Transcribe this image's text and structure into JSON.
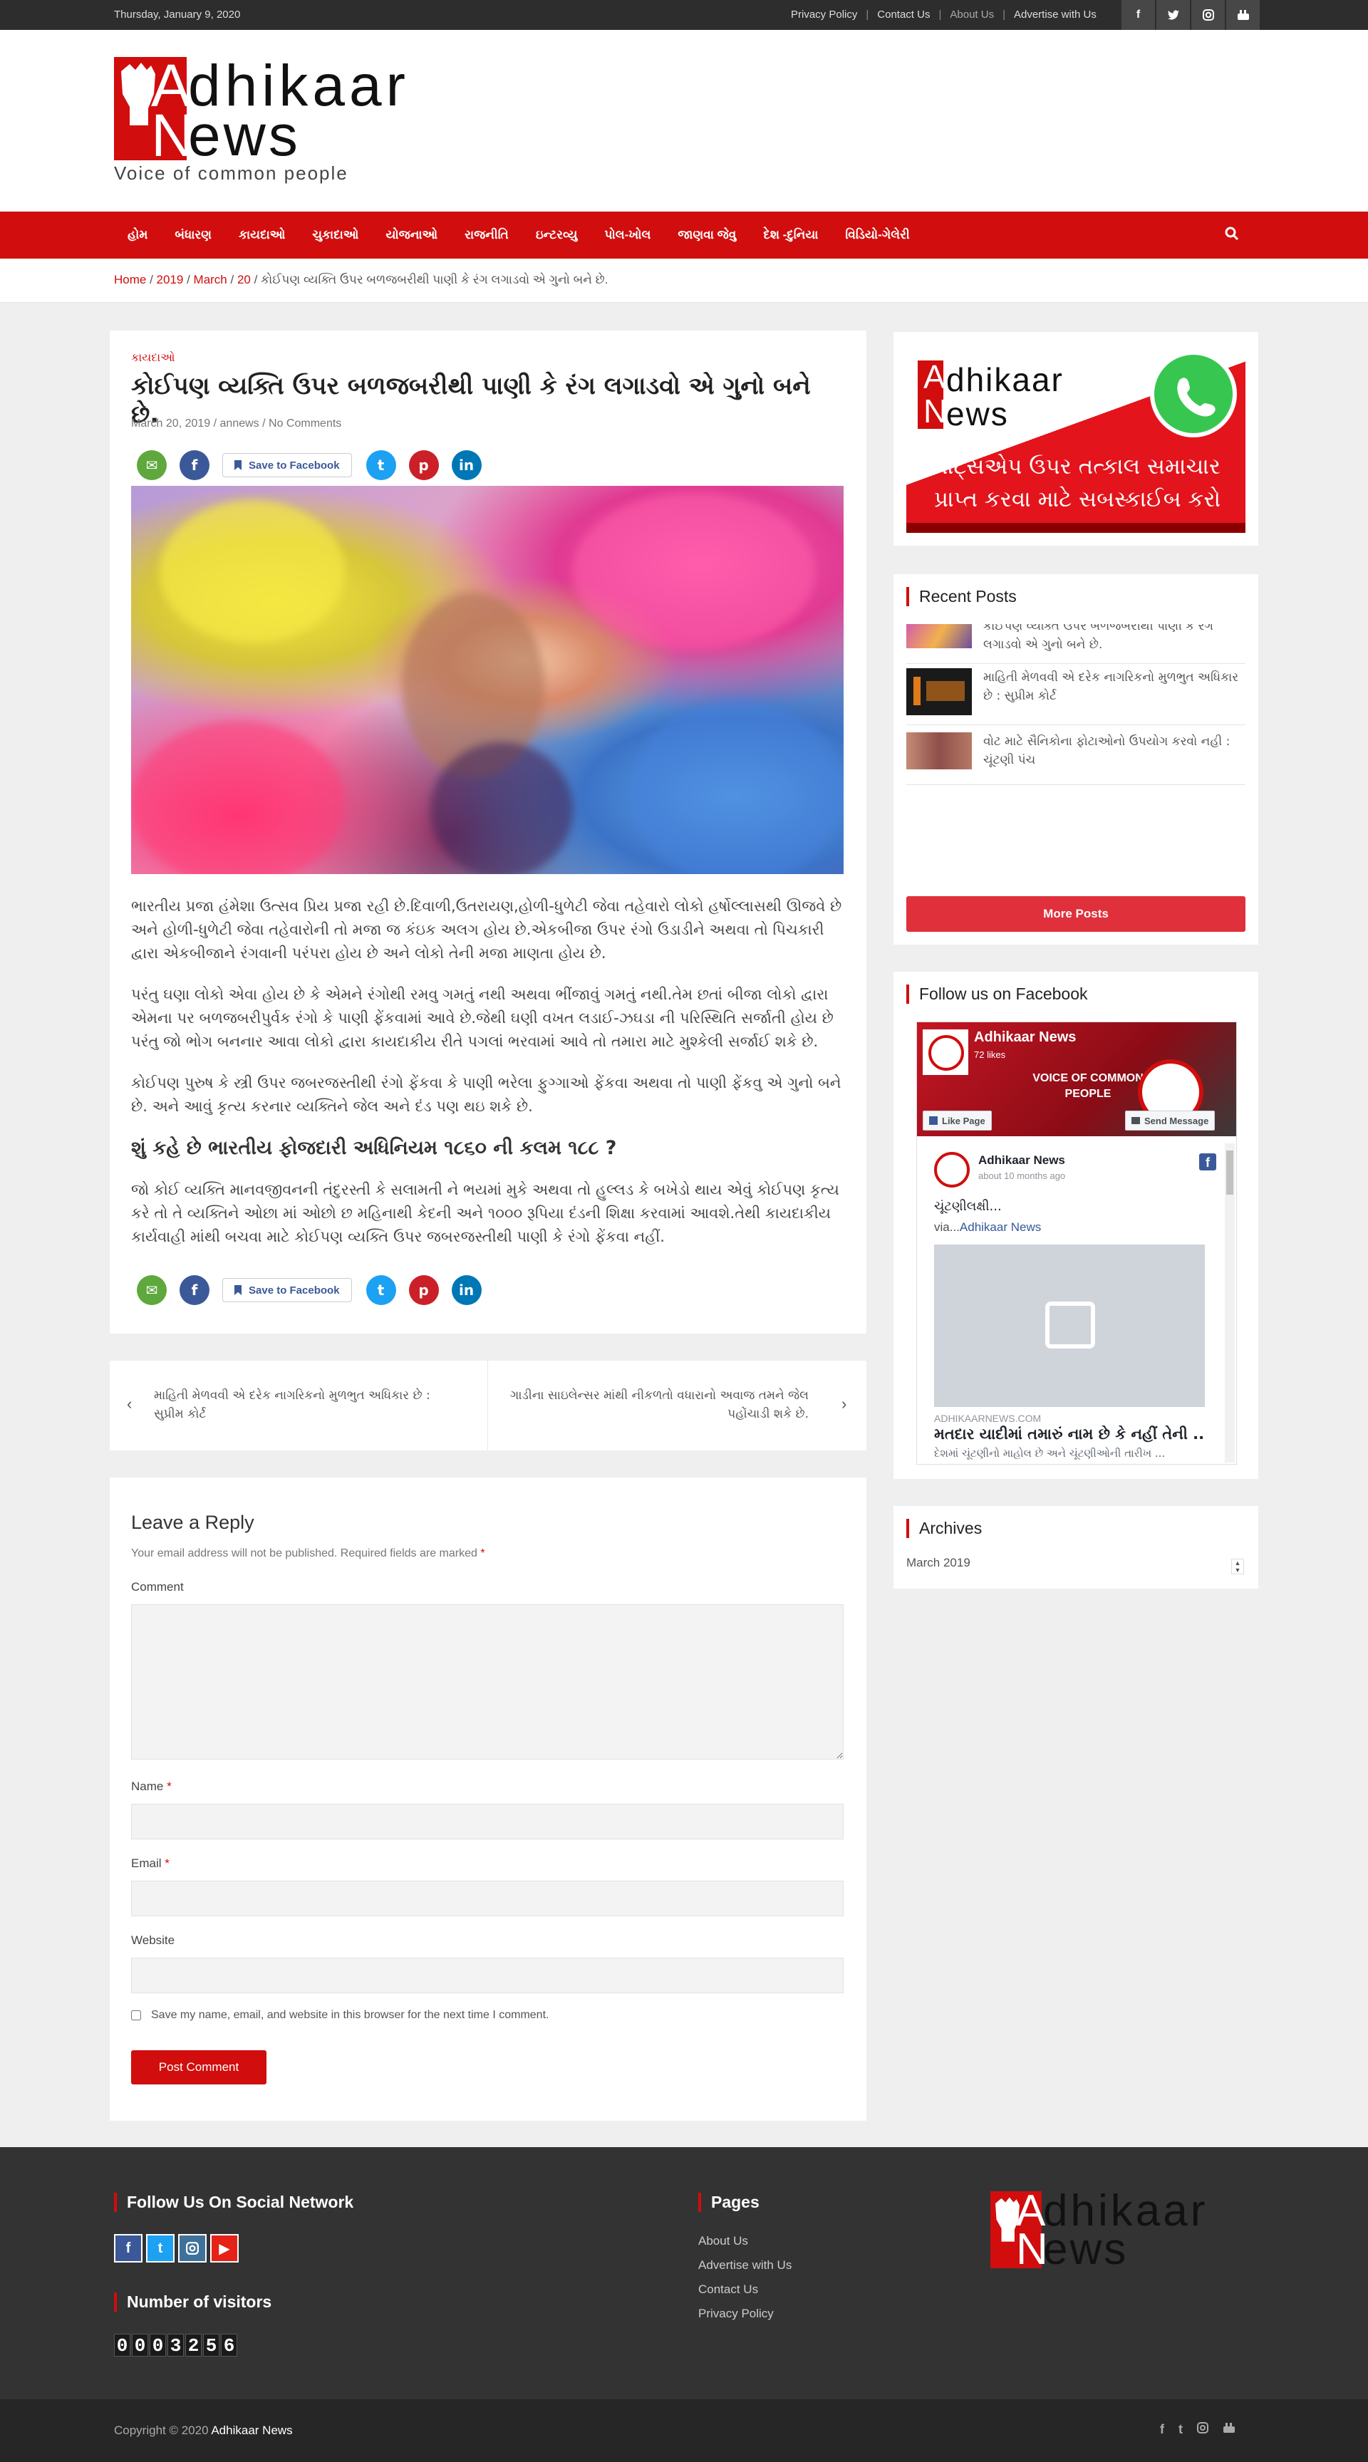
{
  "topbar": {
    "date": "Thursday, January 9, 2020",
    "links": [
      "Privacy Policy",
      "Contact Us",
      "About Us",
      "Advertise with Us"
    ],
    "social_icons": [
      "facebook-icon",
      "twitter-icon",
      "instagram-icon",
      "youtube-icon"
    ]
  },
  "logo": {
    "line1": "dhikaar",
    "line2": "ews",
    "letter1": "A",
    "letter2": "N",
    "tagline": "Voice of common people"
  },
  "nav": {
    "items": [
      "હોમ",
      "બંધારણ",
      "કાયદાઓ",
      "ચુકાદાઓ",
      "યોજનાઓ",
      "રાજનીતિ",
      "ઇન્ટરવ્યુ",
      "પોલ-ખોલ",
      "જાણવા જેવુ",
      "દેશ -દુનિયા",
      "વિડિયો-ગેલેરી"
    ],
    "search_icon": "search-icon"
  },
  "breadcrumb": {
    "home": "Home",
    "year": "2019",
    "month": "March",
    "day": "20",
    "current": "કોઈપણ વ્યક્તિ ઉપર બળજબરીથી પાણી કે રંગ લગાડવો એ ગુનો બને છે."
  },
  "article": {
    "category": "કાયદાઓ",
    "title": "કોઈપણ વ્યક્તિ ઉપર બળજબરીથી પાણી કે રંગ લગાડવો એ ગુનો બને છે.",
    "date": "March 20, 2019",
    "author": "annews",
    "comments": "No Comments",
    "save_label": "Save to Facebook",
    "share_icons": [
      "email-icon",
      "facebook-icon",
      "twitter-icon",
      "pinterest-icon",
      "linkedin-icon"
    ],
    "paragraphs": [
      "ભારતીય પ્રજા હંમેશા ઉત્સવ પ્રિય પ્રજા રહી છે.દિવાળી,ઉતરાયણ,હોળી-ધુળેટી જેવા તહેવારો લોકો હર્ષોલ્લાસથી ઊજવે છે અને હોળી-ધુળેટી જેવા તહેવારોની તો મજા જ કંઇક અલગ હોય છે.એકબીજા ઉપર રંગો ઉડાડીને અથવા તો પિચકારી દ્વારા એકબીજાને રંગવાની પરંપરા હોય છે અને લોકો તેની મજા માણતા હોય છે.",
      "પરંતુ ઘણા લોકો એવા હોય છે કે એમને રંગોથી રમવુ ગમતું નથી અથવા ભીંજાવું ગમતું નથી.તેમ છતાં બીજા લોકો દ્વારા એમના પર બળજબરીપુર્વક રંગો કે પાણી ફેંકવામાં આવે છે.જેથી ઘણી વખત લડાઈ-ઝઘડા ની પરિસ્થિતિ સર્જાતી હોય છે પરંતુ જો ભોગ બનનાર આવા લોકો દ્વારા કાયદાકીય રીતે પગલાં ભરવામાં આવે તો તમારા માટે મુશ્કેલી સર્જાઈ શકે છે.",
      "કોઈપણ પુરુષ કે સ્ત્રી ઉપર જબરજસ્તીથી રંગો ફેંકવા કે પાણી ભરેલા ફુગ્ગાઓ ફેંકવા અથવા તો પાણી ફેંકવુ એ ગુનો બને છે. અને આવું કૃત્ય કરનાર વ્યક્તિને જેલ અને દંડ પણ થઇ શકે છે.",
      "જો કોઈ વ્યક્તિ માનવજીવનની તંદુરસ્તી કે સલામતી ને ભયમાં મુકે અથવા તો હુલ્લડ કે બખેડો થાય એવું કોઈપણ કૃત્ય કરે તો તે વ્યક્તિને ઓછા માં ઓછો છ મહિનાથી કેદની અને ૧૦૦૦ રૂપિયા દંડની શિક્ષા કરવામાં આવશે.તેથી કાયદાકીય કાર્યવાહી માંથી બચવા માટે કોઈપણ વ્યક્તિ ઉપર જબરજસ્તીથી પાણી કે રંગો ફેંકવા નહીં."
    ],
    "subheading": "શું કહે છે ભારતીય ફોજદારી અધિનિયમ ૧૮૬૦ ની કલમ ૧૮૮ ?"
  },
  "postnav": {
    "prev": "માહિતી મેળવવી એ દરેક નાગરિકનો મુળભુત અધિકાર છે : સુપ્રીમ કોર્ટ",
    "next": "ગાડીના સાઇલેન્સર માંથી નીકળતો વધારાનો અવાજ તમને જેલ પહોંચાડી શકે છે."
  },
  "reply": {
    "title": "Leave a Reply",
    "note": "Your email address will not be published. Required fields are marked",
    "req": "*",
    "comment_label": "Comment",
    "name_label": "Name",
    "email_label": "Email",
    "website_label": "Website",
    "checkbox_label": "Save my name, email, and website in this browser for the next time I comment.",
    "submit": "Post Comment"
  },
  "sidebar": {
    "wa_banner": {
      "text": "વૉટ્સએપ ઉપર તત્કાલ સમાચાર પ્રાપ્ત કરવા માટે સબસ્કાઈબ કરો",
      "logo_line1": "dhikaar",
      "logo_line2": "ews",
      "letter1": "A",
      "letter2": "N"
    },
    "recent_title": "Recent Posts",
    "recent_posts": [
      "કોઈપણ વ્યક્તિ ઉપર બળજબરીથી પાણી કે રંગ લગાડવો એ ગુનો બને છે.",
      "માહિતી મેળવવી એ દરેક નાગરિકનો મુળભુત અધિકાર છે : સુપ્રીમ કોર્ટ",
      "વોટ માટે સૈનિકોના ફોટાઓનો ઉપયોગ કરવો નહી : ચૂંટણી પંચ"
    ],
    "more_posts": "More Posts",
    "fb_title": "Follow us on Facebook",
    "fb": {
      "page_name": "Adhikaar News",
      "likes": "72 likes",
      "cover_text": "VOICE OF COMMON PEOPLE",
      "like_page": "Like Page",
      "send_message": "Send Message",
      "post_author": "Adhikaar News",
      "post_time": "about 10 months ago",
      "post_text": "ચૂંટણીલક્ષી...",
      "via_prefix": "via...",
      "via_link": "Adhikaar News",
      "domain": "ADHIKAARNEWS.COM",
      "headline": "મતદાર યાદીમાં તમારું નામ છે કે નહીં તેની ...",
      "subline": "દેશમાં ચૂંટણીનો માહોલ છે અને ચૂંટણીઓની તારીખ ..."
    },
    "archives_title": "Archives",
    "archive_selected": "March 2019"
  },
  "footer": {
    "social_title": "Follow Us On Social Network",
    "visitors_title": "Number of visitors",
    "counter": [
      "0",
      "0",
      "0",
      "3",
      "2",
      "5",
      "6"
    ],
    "pages_title": "Pages",
    "pages": [
      "About Us",
      "Advertise with Us",
      "Contact Us",
      "Privacy Policy"
    ],
    "copyright": "Copyright © 2020",
    "site_name": "Adhikaar News"
  },
  "colors": {
    "brand_red": "#d10d0d",
    "topbar": "#2d2d2d",
    "footer": "#333333"
  }
}
